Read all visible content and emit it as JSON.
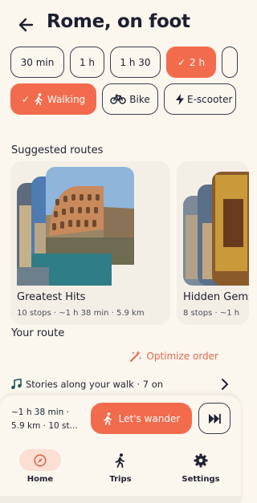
{
  "header": {
    "title": "Rome, on foot",
    "back_icon": "arrow-left-icon"
  },
  "duration_chips": [
    {
      "label": "30 min",
      "selected": false
    },
    {
      "label": "1 h",
      "selected": false
    },
    {
      "label": "1 h 30",
      "selected": false
    },
    {
      "label": "2 h",
      "selected": true
    }
  ],
  "mode_chips": [
    {
      "label": "Walking",
      "icon": "walk-icon",
      "selected": true
    },
    {
      "label": "Bike",
      "icon": "bike-icon",
      "selected": false
    },
    {
      "label": "E-scooter",
      "icon": "bolt-icon",
      "selected": false
    }
  ],
  "suggested": {
    "title": "Suggested routes",
    "routes": [
      {
        "name": "Greatest Hits",
        "meta": "10 stops · ~1 h 38 min · 5.9 km"
      },
      {
        "name": "Hidden Gems",
        "meta": "8 stops · ~1 h"
      }
    ]
  },
  "your_route": {
    "title": "Your route",
    "optimize_label": "Optimize order"
  },
  "stories": {
    "label": "Stories along your walk · 7 on",
    "icon": "music-note-icon"
  },
  "bottom": {
    "summary_line1": "~1 h 38 min ·",
    "summary_line2": "5.9 km · 10 st...",
    "wander_label": "Let's wander",
    "skip_icon": "fast-forward-icon"
  },
  "nav": [
    {
      "label": "Home",
      "icon": "compass-icon",
      "active": true
    },
    {
      "label": "Trips",
      "icon": "walk-icon",
      "active": false
    },
    {
      "label": "Settings",
      "icon": "gear-icon",
      "active": false
    }
  ],
  "colors": {
    "accent": "#f26b4c",
    "background": "#fbf6ee",
    "text": "#1f2233"
  }
}
